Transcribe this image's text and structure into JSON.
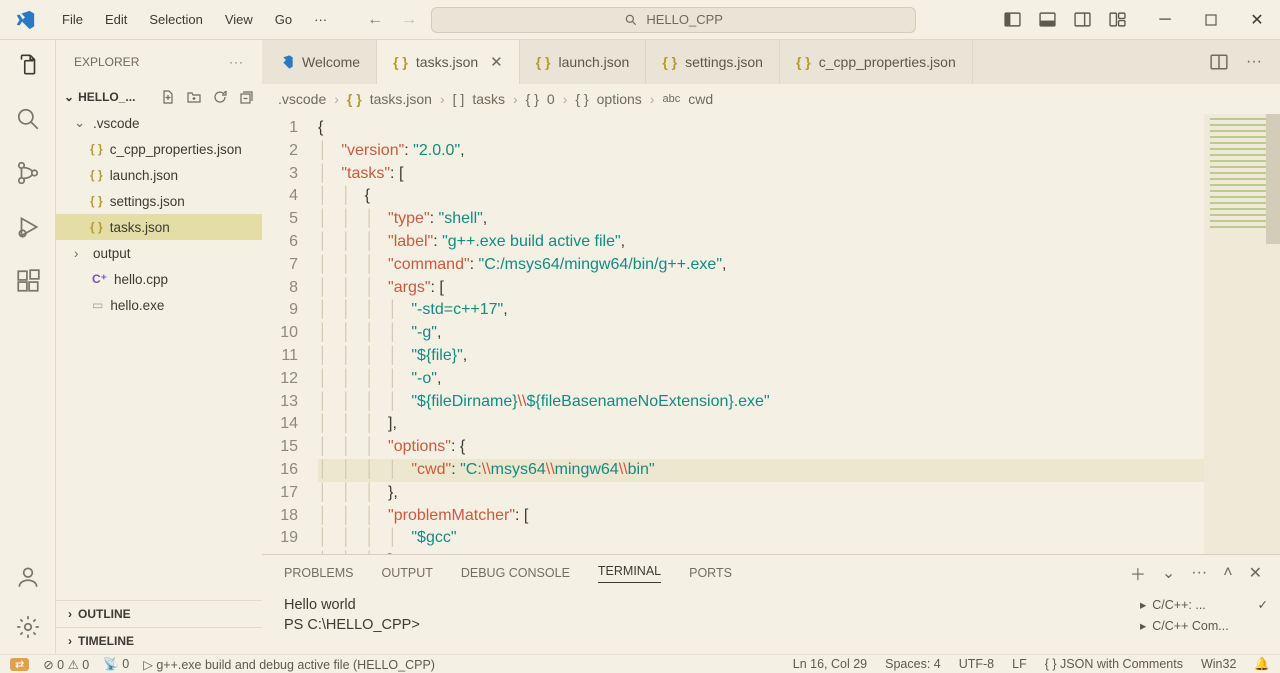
{
  "menu": {
    "file": "File",
    "edit": "Edit",
    "selection": "Selection",
    "view": "View",
    "go": "Go"
  },
  "search_text": "HELLO_CPP",
  "sidebar": {
    "title": "EXPLORER",
    "root": "HELLO_...",
    "tree": [
      {
        "label": ".vscode"
      },
      {
        "label": "c_cpp_properties.json"
      },
      {
        "label": "launch.json"
      },
      {
        "label": "settings.json"
      },
      {
        "label": "tasks.json"
      },
      {
        "label": "output"
      },
      {
        "label": "hello.cpp"
      },
      {
        "label": "hello.exe"
      }
    ],
    "outline": "OUTLINE",
    "timeline": "TIMELINE"
  },
  "tabs": [
    {
      "label": "Welcome",
      "icon": "vs"
    },
    {
      "label": "tasks.json",
      "icon": "{}",
      "active": true,
      "closable": true
    },
    {
      "label": "launch.json",
      "icon": "{}"
    },
    {
      "label": "settings.json",
      "icon": "{}"
    },
    {
      "label": "c_cpp_properties.json",
      "icon": "{}"
    }
  ],
  "breadcrumb": [
    ".vscode",
    "tasks.json",
    "tasks",
    "0",
    "options",
    "cwd"
  ],
  "code_lines": [
    "{",
    "    \"version\": \"2.0.0\",",
    "    \"tasks\": [",
    "        {",
    "            \"type\": \"shell\",",
    "            \"label\": \"g++.exe build active file\",",
    "            \"command\": \"C:/msys64/mingw64/bin/g++.exe\",",
    "            \"args\": [",
    "                \"-std=c++17\",",
    "                \"-g\",",
    "                \"${file}\",",
    "                \"-o\",",
    "                \"${fileDirname}\\\\${fileBasenameNoExtension}.exe\"",
    "            ],",
    "            \"options\": {",
    "                \"cwd\": \"C:\\\\msys64\\\\mingw64\\\\bin\"",
    "            },",
    "            \"problemMatcher\": [",
    "                \"$gcc\"",
    "            ],"
  ],
  "highlight_line": 16,
  "panel": {
    "tabs": [
      "PROBLEMS",
      "OUTPUT",
      "DEBUG CONSOLE",
      "TERMINAL",
      "PORTS"
    ],
    "active": "TERMINAL",
    "terminal": [
      "Hello world",
      "PS C:\\HELLO_CPP>"
    ],
    "tasks": [
      "C/C++: ...",
      "C/C++ Com..."
    ]
  },
  "status": {
    "errors": "0",
    "warnings": "0",
    "ports": "0",
    "launch": "g++.exe build and debug active file (HELLO_CPP)",
    "pos": "Ln 16, Col 29",
    "spaces": "Spaces: 4",
    "enc": "UTF-8",
    "eol": "LF",
    "lang": "JSON with Comments",
    "os": "Win32"
  }
}
